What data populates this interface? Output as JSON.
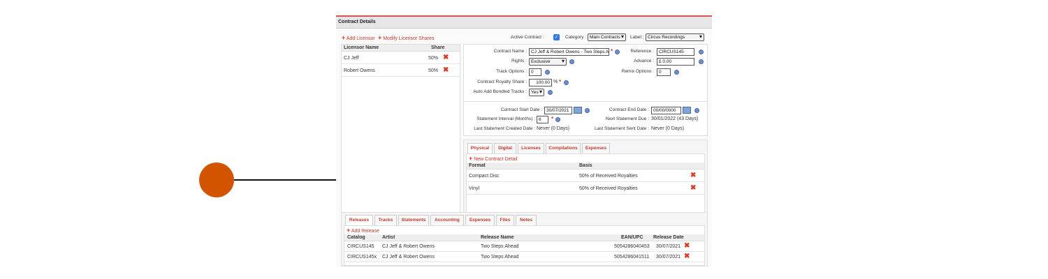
{
  "header": {
    "title": "Contract Details"
  },
  "licensors": {
    "add_label": "Add Licensor",
    "modify_label": "Modify Licensor Shares",
    "col_name": "Licensor Name",
    "col_share": "Share",
    "rows": [
      {
        "name": "CJ Jeff",
        "share": "50%"
      },
      {
        "name": "Robert Owens",
        "share": "50%"
      }
    ]
  },
  "top_controls": {
    "active_label": "Active Contract :",
    "category_label": "Category :",
    "category_value": "Main Contracts",
    "label_label": "Label :",
    "label_value": "Circus Recordings"
  },
  "form": {
    "contract_name_label": "Contract Name :",
    "contract_name_value": "CJ Jeff & Robert Owens - Two Steps Al",
    "reference_label": "Reference :",
    "reference_value": "CIRCUS145",
    "rights_label": "Rights :",
    "rights_value": "Exclusive",
    "advance_label": "Advance :",
    "advance_value": "£ 0.00",
    "track_options_label": "Track Options :",
    "track_options_value": "0",
    "remix_options_label": "Remix Options :",
    "remix_options_value": "0",
    "royalty_share_label": "Contract Royalty Share :",
    "royalty_share_value": "100.00",
    "royalty_share_unit": "%",
    "auto_add_label": "Auto Add Bundled Tracks :",
    "auto_add_value": "Yes"
  },
  "dates": {
    "start_label": "Contract Start Date :",
    "start_value": "30/07/2021",
    "end_label": "Contract End Date :",
    "end_value": "00/00/0000",
    "interval_label": "Statement Interval (Months) :",
    "interval_value": "6",
    "next_due_label": "Next Statement Due :",
    "next_due_value": "30/01/2022 (43 Days)",
    "last_created_label": "Last Statement Created Date :",
    "last_created_value": "Never (0 Days)",
    "last_sent_label": "Last Statement Sent Date :",
    "last_sent_value": "Never (0 Days)"
  },
  "detail_tabs": [
    "Physical",
    "Digital",
    "Licenses",
    "Compilations",
    "Expenses"
  ],
  "details": {
    "new_label": "New Contract Detail",
    "col_format": "Format",
    "col_basis": "Basis",
    "rows": [
      {
        "format": "Compact Disc",
        "basis": "50% of Received Royalties"
      },
      {
        "format": "Vinyl",
        "basis": "50% of Received Royalties"
      }
    ]
  },
  "release_tabs": [
    "Releases",
    "Tracks",
    "Statements",
    "Accounting",
    "Expenses",
    "Files",
    "Notes"
  ],
  "releases": {
    "add_label": "Add Release",
    "col_catalog": "Catalog",
    "col_artist": "Artist",
    "col_name": "Release Name",
    "col_ean": "EAN/UPC",
    "col_date": "Release Date",
    "rows": [
      {
        "catalog": "CIRCUS145",
        "artist": "CJ Jeff & Robert Owens",
        "name": "Two Steps Ahead",
        "ean": "5054286040453",
        "date": "30/07/2021"
      },
      {
        "catalog": "CIRCUS145x",
        "artist": "CJ Jeff & Robert Owens",
        "name": "Two Steps Ahead",
        "ean": "5054286041511",
        "date": "30/07/2021"
      }
    ]
  },
  "colors": {
    "accent": "#d35400",
    "link": "#c0392b",
    "header_bg": "#e6e6e6"
  }
}
